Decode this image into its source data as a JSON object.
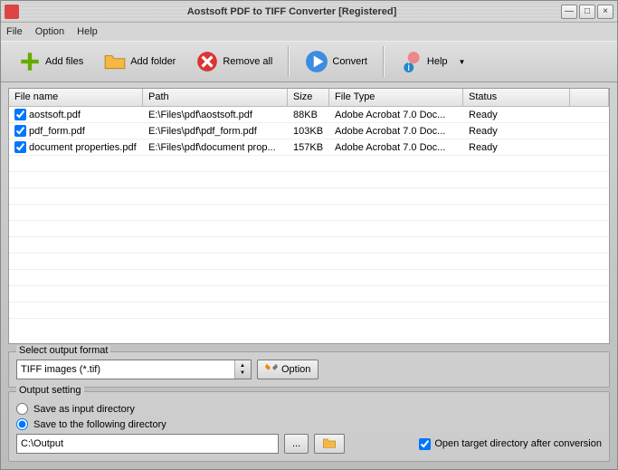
{
  "title": "Aostsoft PDF to TIFF Converter [Registered]",
  "menu": {
    "file": "File",
    "option": "Option",
    "help": "Help"
  },
  "toolbar": {
    "addfiles": "Add files",
    "addfolder": "Add folder",
    "removeall": "Remove all",
    "convert": "Convert",
    "help": "Help"
  },
  "columns": {
    "filename": "File name",
    "path": "Path",
    "size": "Size",
    "filetype": "File Type",
    "status": "Status"
  },
  "rows": [
    {
      "name": "aostsoft.pdf",
      "path": "E:\\Files\\pdf\\aostsoft.pdf",
      "size": "88KB",
      "type": "Adobe Acrobat 7.0 Doc...",
      "status": "Ready"
    },
    {
      "name": "pdf_form.pdf",
      "path": "E:\\Files\\pdf\\pdf_form.pdf",
      "size": "103KB",
      "type": "Adobe Acrobat 7.0 Doc...",
      "status": "Ready"
    },
    {
      "name": "document properties.pdf",
      "path": "E:\\Files\\pdf\\document prop...",
      "size": "157KB",
      "type": "Adobe Acrobat 7.0 Doc...",
      "status": "Ready"
    }
  ],
  "format_section": {
    "legend": "Select output format",
    "selected": "TIFF images (*.tif)",
    "option_btn": "Option"
  },
  "output_section": {
    "legend": "Output setting",
    "save_as_input": "Save as input directory",
    "save_following": "Save to the following directory",
    "path_value": "C:\\Output",
    "browse_btn": "...",
    "open_after": "Open target directory after conversion"
  }
}
